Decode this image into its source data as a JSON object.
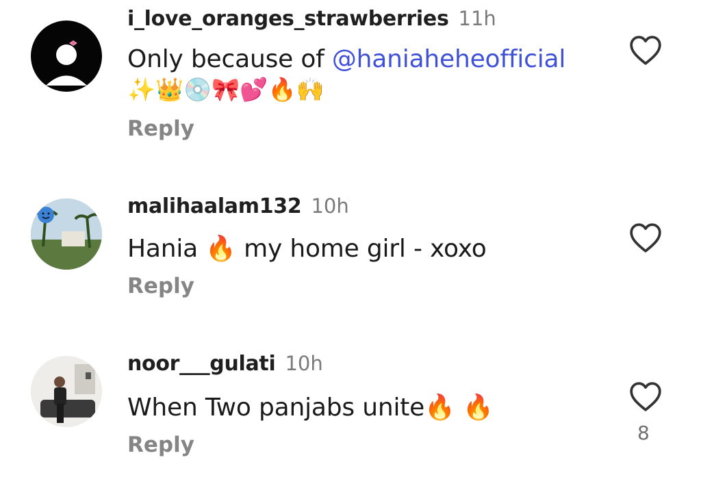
{
  "comments": [
    {
      "username": "i_love_oranges_strawberries",
      "time": "11h",
      "text_prefix": "Only because of ",
      "mention": "@haniaheheofficial",
      "emoji_line": "✨👑💿🎀💕🔥🙌",
      "reply_label": "Reply"
    },
    {
      "username": "malihaalam132",
      "time": "10h",
      "text_a": "Hania ",
      "text_emoji": "🔥",
      "text_b": " my home girl - xoxo",
      "reply_label": "Reply"
    },
    {
      "username": "noor___gulati",
      "time": "10h",
      "text": "When Two panjabs unite",
      "text_emoji": "🔥 🔥",
      "reply_label": "Reply",
      "like_count": "8"
    }
  ],
  "icons": {
    "like": "heart-outline-icon"
  }
}
